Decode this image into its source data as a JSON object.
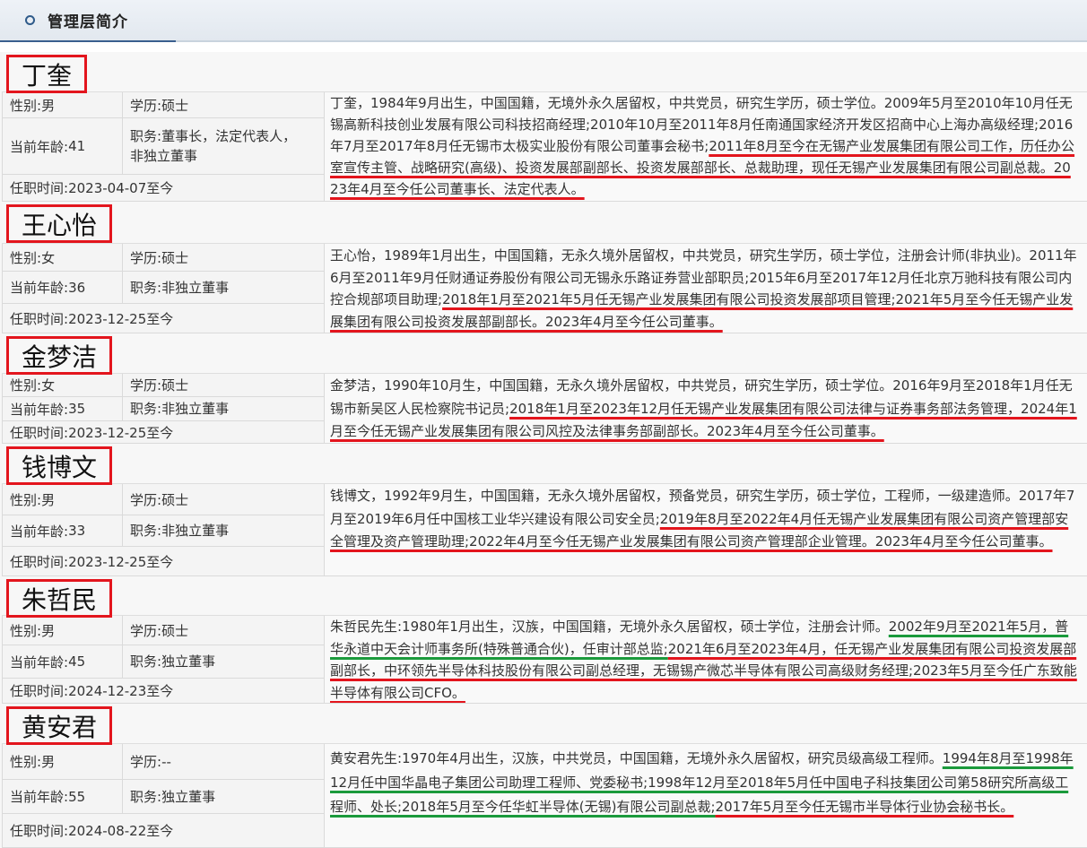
{
  "header": {
    "title": "管理层简介"
  },
  "labels": {
    "gender": "性别:",
    "education": "学历:",
    "age": "当前年龄:",
    "position": "职务:",
    "tenure": "任职时间:"
  },
  "annotation_colors": {
    "name_box": "#e3151d",
    "red": "#e3151d",
    "green": "#1b9a3c"
  },
  "people": [
    {
      "name": "丁奎",
      "gender": "男",
      "education": "硕士",
      "age": "41",
      "position": "董事长，法定代表人，非独立董事",
      "tenure": "2023-04-07至今",
      "bio": [
        {
          "text": "丁奎，1984年9月出生，中国国籍，无境外永久居留权，中共党员，研究生学历，硕士学位。2009年5月至2010年10月任无锡高新科技创业发展有限公司科技招商经理;2010年10月至2011年8月任南通国家经济开发区招商中心上海办高级经理;2016年7月至2017年8月任无锡市太极实业股份有限公司董事会秘书;"
        },
        {
          "text": "2011年8月至今在无锡产业发展集团有限公司工作，历任办公室宣传主管、战略研究(高级)、投资发展部副部长、投资发展部部长、总裁助理，现任无锡产业发展集团有限公司副总裁。2023年4月至今任公司董事长、法定代表人。",
          "mark": "red"
        }
      ]
    },
    {
      "name": "王心怡",
      "gender": "女",
      "education": "硕士",
      "age": "36",
      "position": "非独立董事",
      "tenure": "2023-12-25至今",
      "bio": [
        {
          "text": "王心怡，1989年1月出生，中国国籍，无永久境外居留权，中共党员，研究生学历，硕士学位，注册会计师(非执业)。2011年6月至2011年9月任财通证券股份有限公司无锡永乐路证券营业部职员;2015年6月至2017年12月任北京万驰科技有限公司内控合规部项目助理;"
        },
        {
          "text": "2018年1月至2021年5月任无锡产业发展集团有限公司投资发展部项目管理;2021年5月至今任无锡产业发展集团有限公司投资发展部副部长。2023年4月至今任公司董事。",
          "mark": "red"
        }
      ]
    },
    {
      "name": "金梦洁",
      "gender": "女",
      "education": "硕士",
      "age": "35",
      "position": "非独立董事",
      "tenure": "2023-12-25至今",
      "bio": [
        {
          "text": "金梦洁，1990年10月生，中国国籍，无永久境外居留权，中共党员，研究生学历，硕士学位。2016年9月至2018年1月任无锡市新吴区人民检察院书记员;"
        },
        {
          "text": "2018年1月至2023年12月任无锡产业发展集团有限公司法律与证券事务部法务管理，2024年1月至今任无锡产业发展集团有限公司风控及法律事务部副部长。2023年4月至今任公司董事。",
          "mark": "red"
        }
      ]
    },
    {
      "name": "钱博文",
      "gender": "男",
      "education": "硕士",
      "age": "33",
      "position": "非独立董事",
      "tenure": "2023-12-25至今",
      "bio": [
        {
          "text": "钱博文，1992年9月生，中国国籍，无永久境外居留权，预备党员，研究生学历，硕士学位，工程师，一级建造师。2017年7月至2019年6月任中国核工业华兴建设有限公司安全员;"
        },
        {
          "text": "2019年8月至2022年4月任无锡产业发展集团有限公司资产管理部安全管理及资产管理助理;2022年4月至今任无锡产业发展集团有限公司资产管理部企业管理。2023年4月至今任公司董事。",
          "mark": "red"
        }
      ]
    },
    {
      "name": "朱哲民",
      "gender": "男",
      "education": "硕士",
      "age": "45",
      "position": "独立董事",
      "tenure": "2024-12-23至今",
      "bio": [
        {
          "text": "朱哲民先生:1980年1月出生，汉族，中国国籍，无境外永久居留权，硕士学位，注册会计师。"
        },
        {
          "text": "2002年9月至2021年5月，普华永道中天会计师事务所(特殊普通合伙)，任审计部总监;",
          "mark": "green"
        },
        {
          "text": "2021年6月至2023年4月，任无锡产业发展集团有限公司投资发展部副部长，中环领先半导体科技股份有限公司副总经理，无锡锡产微芯半导体有限公司高级财务经理;2023年5月至今任广东致能半导体有限公司CFO。",
          "mark": "red"
        }
      ]
    },
    {
      "name": "黄安君",
      "gender": "男",
      "education": "--",
      "age": "55",
      "position": "独立董事",
      "tenure": "2024-08-22至今",
      "bio": [
        {
          "text": "黄安君先生:1970年4月出生，汉族，中共党员，中国国籍，无境外永久居留权，研究员级高级工程师。"
        },
        {
          "text": "1994年8月至1998年12月任中国华晶电子集团公司助理工程师、党委秘书;1998年12月至2018年5月任中国电子科技集团公司第58研究所高级工程师、处长;2018年5月至今任华虹半导体(无锡)有限公司副总裁;",
          "mark": "green"
        },
        {
          "text": "2017年5月至今任无锡市半导体行业协会秘书长。",
          "mark": "red"
        }
      ]
    }
  ]
}
